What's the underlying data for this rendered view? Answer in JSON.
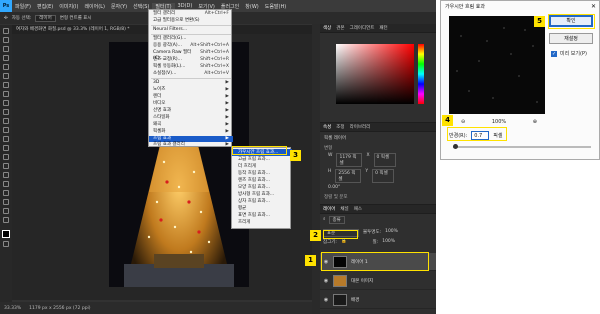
{
  "menubar": {
    "app_logo": "Ps",
    "items": [
      "파일(F)",
      "편집(E)",
      "이미지(I)",
      "레이어(L)",
      "문자(Y)",
      "선택(S)",
      "필터(T)",
      "3D(D)",
      "보기(V)",
      "플러그인",
      "창(W)",
      "도움말(H)"
    ]
  },
  "options_bar": {
    "auto_select": "자동 선택:",
    "layer_select": "레이어",
    "transform": "변형 컨트롤 표시"
  },
  "document_tab": "여자와 배경화면 화질.psd @ 33.3% (레이어 1, RGB/8) *",
  "status": {
    "zoom": "33.33%",
    "info": "1179 px x 2556 px (72 ppi)"
  },
  "filter_menu": {
    "items": [
      {
        "label": "필터 갤러리",
        "shortcut": "Alt+Ctrl+F"
      },
      {
        "label": "고급 필터용으로 변환(S)",
        "shortcut": ""
      },
      {
        "label": "Neural Filters...",
        "shortcut": ""
      },
      {
        "label": "필터 갤러리(G)...",
        "shortcut": ""
      },
      {
        "label": "응용 광각(A)...",
        "shortcut": "Alt+Shift+Ctrl+A"
      },
      {
        "label": "Camera Raw 필터(C)...",
        "shortcut": "Shift+Ctrl+A"
      },
      {
        "label": "렌즈 교정(R)...",
        "shortcut": "Shift+Ctrl+R"
      },
      {
        "label": "픽셀 유동화(L)...",
        "shortcut": "Shift+Ctrl+X"
      },
      {
        "label": "소실점(V)...",
        "shortcut": "Alt+Ctrl+V"
      },
      {
        "label": "3D",
        "shortcut": ""
      },
      {
        "label": "노이즈",
        "shortcut": ""
      },
      {
        "label": "렌더",
        "shortcut": ""
      },
      {
        "label": "비디오",
        "shortcut": ""
      },
      {
        "label": "선명 효과",
        "shortcut": ""
      },
      {
        "label": "스타일화",
        "shortcut": ""
      },
      {
        "label": "왜곡",
        "shortcut": ""
      },
      {
        "label": "픽셀화",
        "shortcut": ""
      },
      {
        "label": "흐림 효과",
        "shortcut": ""
      },
      {
        "label": "흐림 효과 갤러리",
        "shortcut": ""
      },
      {
        "label": "기타",
        "shortcut": ""
      }
    ]
  },
  "blur_submenu": {
    "items": [
      "가우시안 흐림 효과...",
      "고급 흐림 효과...",
      "더 흐리게",
      "동작 흐림 효과...",
      "렌즈 흐림 효과...",
      "모양 흐림 효과...",
      "방사형 흐림 효과...",
      "상자 흐림 효과...",
      "평균",
      "표면 흐림 효과...",
      "흐리게"
    ]
  },
  "right_panels": {
    "color_tabs": [
      "색상",
      "견본",
      "그레이디언트",
      "패턴"
    ],
    "props_tabs": [
      "속성",
      "조정",
      "라이브러리"
    ],
    "props_title": "픽셀 레이어",
    "transform_title": "변형",
    "w_label": "W",
    "w_value": "1179 픽셀",
    "h_label": "H",
    "h_value": "2556 픽셀",
    "x_label": "X",
    "x_value": "0 픽셀",
    "y_label": "Y",
    "y_value": "0 픽셀",
    "angle": "0.00°",
    "align_title": "정렬 및 분포",
    "layers_tabs": [
      "레이어",
      "채널",
      "패스"
    ],
    "search_kind": "종류",
    "blend_mode": "표준",
    "opacity_label": "불투명도:",
    "opacity_value": "100%",
    "lock_label": "잠그기:",
    "fill_label": "칠:",
    "fill_value": "100%",
    "layers": [
      {
        "name": "레이어 1"
      },
      {
        "name": "대본 이미지"
      },
      {
        "name": "배경"
      }
    ]
  },
  "gaussian_dialog": {
    "title": "가우시안 흐림 효과",
    "ok": "확인",
    "cancel": "재설정",
    "preview_label": "미리 보기(P)",
    "zoom_out": "⊖",
    "zoom_value": "100%",
    "zoom_in": "⊕",
    "radius_label": "반경(R):",
    "radius_value": "0.7",
    "radius_unit": "픽셀"
  },
  "callouts": [
    "1",
    "2",
    "3",
    "4",
    "5"
  ],
  "colors": {
    "highlight": "#ffe200",
    "menu_selected": "#1a5bc8",
    "ps_blue": "#31a8ff"
  }
}
